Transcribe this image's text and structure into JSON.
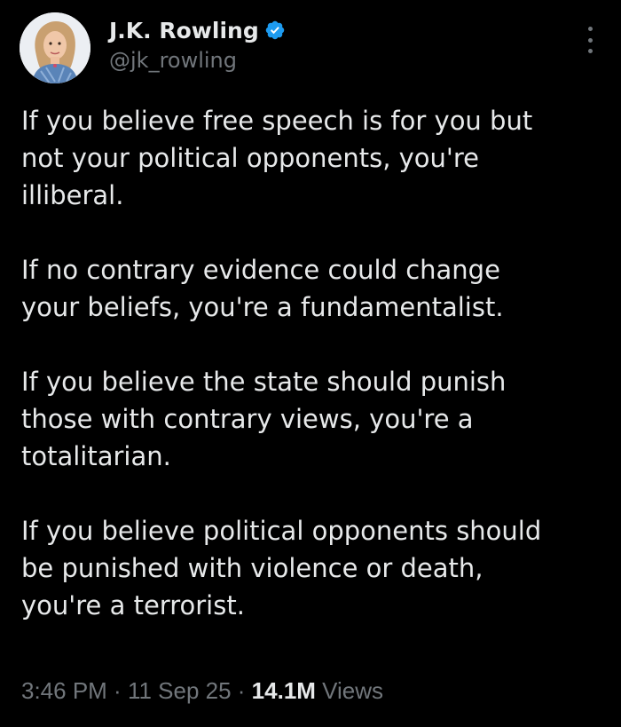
{
  "author": {
    "display_name": "J.K. Rowling",
    "handle": "@jk_rowling",
    "verified": true,
    "avatar_icon": "profile-photo-icon",
    "verified_icon": "verified-badge-icon"
  },
  "menu_icon": "more-options-icon",
  "tweet": {
    "paragraphs": [
      "If you believe free speech is for you but\nnot your political opponents, you're\nilliberal.",
      "If no contrary evidence could change\nyour beliefs, you're a fundamentalist.",
      "If you believe the state should punish\nthose with contrary views, you're a\ntotalitarian.",
      "If you believe political opponents should\nbe punished with violence or death,\nyou're a terrorist."
    ]
  },
  "meta": {
    "time": "3:46 PM",
    "separator": " · ",
    "date": "11 Sep 25",
    "views_count": "14.1M",
    "views_label": " Views"
  },
  "colors": {
    "background": "#000000",
    "text": "#e7e9ea",
    "secondary": "#71767b",
    "verified_blue": "#1d9bf0"
  }
}
